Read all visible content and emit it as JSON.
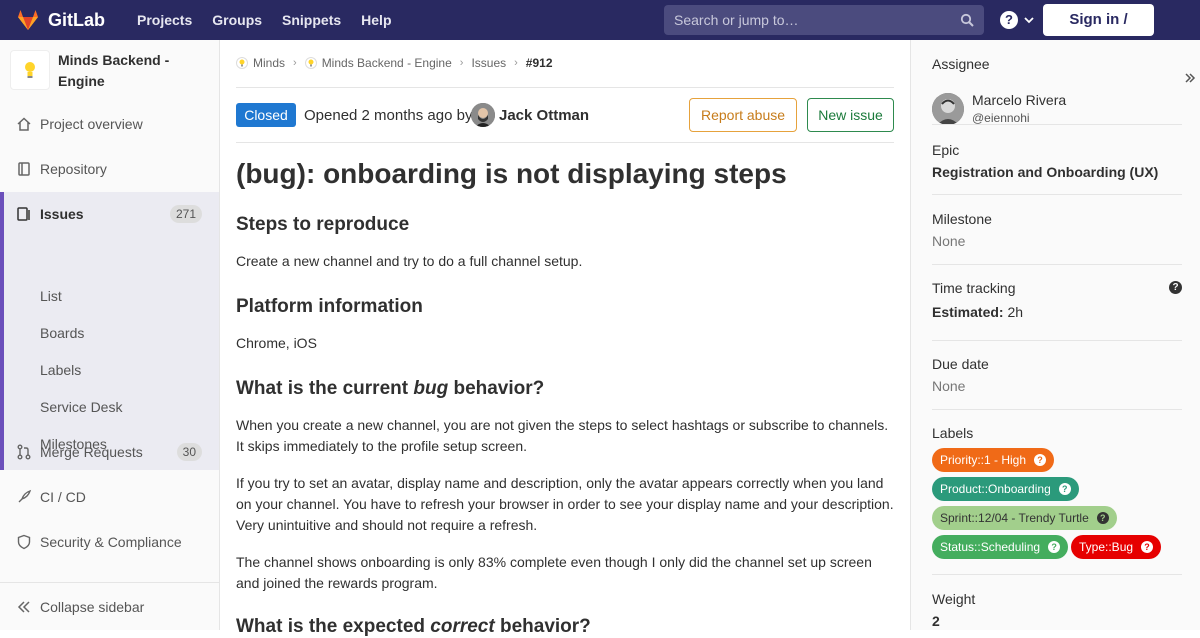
{
  "navbar": {
    "brand": "GitLab",
    "links": [
      "Projects",
      "Groups",
      "Snippets",
      "Help"
    ],
    "search_placeholder": "Search or jump to…",
    "signin_label": "Sign in / Register"
  },
  "sidebar": {
    "project_name": "Minds Backend - Engine",
    "items": [
      {
        "label": "Project overview",
        "icon": "home-icon"
      },
      {
        "label": "Repository",
        "icon": "book-icon"
      },
      {
        "label": "Issues",
        "icon": "issues-icon",
        "count": "271"
      },
      {
        "label": "Merge Requests",
        "icon": "merge-request-icon",
        "count": "30"
      },
      {
        "label": "CI / CD",
        "icon": "rocket-icon"
      },
      {
        "label": "Security & Compliance",
        "icon": "shield-icon"
      }
    ],
    "issues_subitems": [
      "List",
      "Boards",
      "Labels",
      "Service Desk",
      "Milestones"
    ],
    "collapse_label": "Collapse sidebar"
  },
  "breadcrumb": {
    "items": [
      "Minds",
      "Minds Backend - Engine",
      "Issues",
      "#912"
    ]
  },
  "issue": {
    "status": "Closed",
    "opened_text": "Opened 2 months ago by",
    "author": "Jack Ottman",
    "report_label": "Report abuse",
    "new_label": "New issue",
    "title": "(bug): onboarding is not displaying steps",
    "sections": {
      "steps_heading": "Steps to reproduce",
      "steps_text": "Create a new channel and try to do a full channel setup.",
      "platform_heading": "Platform information",
      "platform_text": "Chrome, iOS",
      "current_heading_pre": "What is the current ",
      "current_heading_em": "bug",
      "current_heading_post": " behavior?",
      "current_p1": "When you create a new channel, you are not given the steps to select hashtags or subscribe to channels. It skips immediately to the profile setup screen.",
      "current_p2": "If you try to set an avatar, display name and description, only the avatar appears correctly when you land on your channel. You have to refresh your browser in order to see your display name and your description. Very unintuitive and should not require a refresh.",
      "current_p3": "The channel shows onboarding is only 83% complete even though I only did the channel set up screen and joined the rewards program.",
      "expected_heading_pre": "What is the expected ",
      "expected_heading_em": "correct",
      "expected_heading_post": " behavior?"
    }
  },
  "right_panel": {
    "assignee_title": "Assignee",
    "assignee_name": "Marcelo Rivera",
    "assignee_handle": "@eiennohi",
    "epic_title": "Epic",
    "epic_value": "Registration and Onboarding (UX)",
    "milestone_title": "Milestone",
    "milestone_value": "None",
    "time_title": "Time tracking",
    "time_estimated_label": "Estimated:",
    "time_estimated_value": "2h",
    "due_title": "Due date",
    "due_value": "None",
    "labels_title": "Labels",
    "labels": [
      {
        "text": "Priority::1 - High",
        "color": "#f06a17"
      },
      {
        "text": "Product::Onboarding",
        "color": "#2b9a7b"
      },
      {
        "text": "Sprint::12/04 - Trendy Turtle",
        "color": "#a2cf8c",
        "text_color": "#333333"
      },
      {
        "text": "Status::Scheduling",
        "color": "#44ad5e"
      },
      {
        "text": "Type::Bug",
        "color": "#e60000"
      }
    ],
    "weight_title": "Weight",
    "weight_value": "2"
  }
}
